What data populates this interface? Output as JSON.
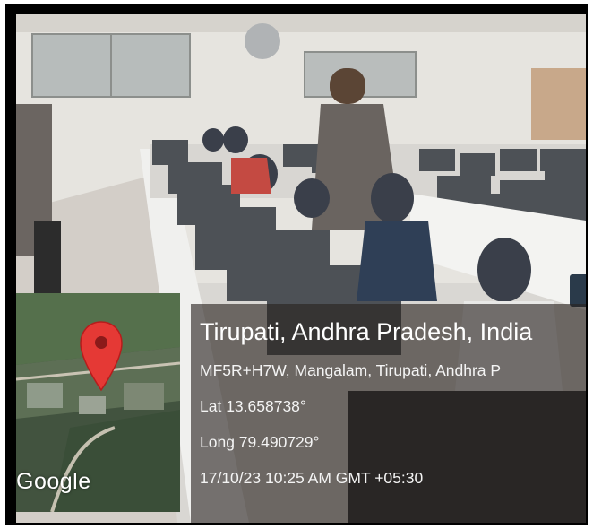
{
  "location": {
    "title": "Tirupati, Andhra Pradesh, India",
    "address": "MF5R+H7W, Mangalam, Tirupati, Andhra P",
    "lat": "Lat 13.658738°",
    "long": "Long 79.490729°",
    "datetime": "17/10/23 10:25 AM GMT +05:30"
  },
  "map": {
    "provider_logo": "Google",
    "marker_icon": "map-pin-icon",
    "marker_color": "#e53935"
  },
  "photo": {
    "scene_colors": {
      "wall": "#e8e6e2",
      "floor": "#cfcac4",
      "monitor": "#5c5f63",
      "partition": "#f2f2f2"
    }
  }
}
